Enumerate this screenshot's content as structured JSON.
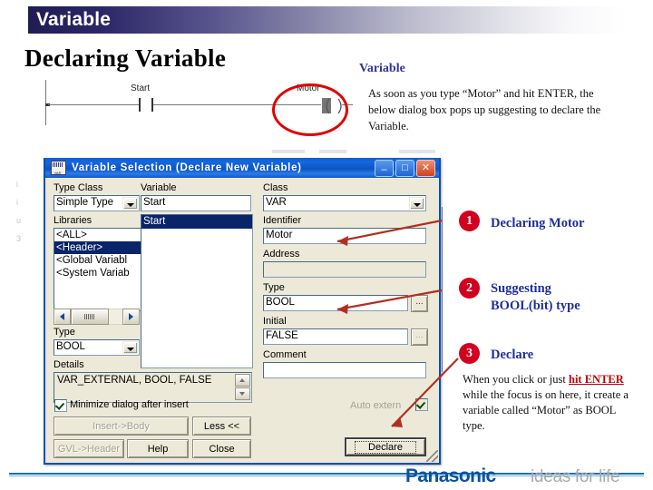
{
  "slide": {
    "header_title": "Variable",
    "page_title": "Declaring Variable"
  },
  "right_panel": {
    "heading": "Variable",
    "paragraph": "As soon as you type “Motor” and hit ENTER, the below dialog box pops up suggesting to declare the Variable."
  },
  "ladder": {
    "contact_label": "Start",
    "coil_label": "Motor"
  },
  "dialog": {
    "title": "Variable Selection (Declare New Variable)",
    "icon": "variable-window-icon",
    "titlebar_buttons": [
      {
        "name": "minimize",
        "glyph": "–"
      },
      {
        "name": "maximize",
        "glyph": "□"
      },
      {
        "name": "close",
        "glyph": "✕"
      }
    ],
    "left_column": {
      "type_class_label": "Type Class",
      "type_class_value": "Simple Type",
      "libraries_label": "Libraries",
      "libraries_items": [
        {
          "label": "<ALL>",
          "selected": false
        },
        {
          "label": "<Header>",
          "selected": true
        },
        {
          "label": "<Global Variabl",
          "selected": false
        },
        {
          "label": "<System Variab",
          "selected": false
        }
      ],
      "type_label": "Type",
      "type_value": "BOOL",
      "details_label": "Details",
      "details_value": "VAR_EXTERNAL, BOOL, FALSE"
    },
    "middle_column": {
      "variable_label": "Variable",
      "variable_value": "Start",
      "variable_list": [
        {
          "label": "Start",
          "selected": true
        }
      ]
    },
    "right_column": {
      "class_label": "Class",
      "class_value": "VAR",
      "identifier_label": "Identifier",
      "identifier_value": "Motor",
      "address_label": "Address",
      "address_value": "",
      "type_label": "Type",
      "type_value": "BOOL",
      "type_browse_label": "...",
      "initial_label": "Initial",
      "initial_value": "FALSE",
      "initial_browse_label": "...",
      "comment_label": "Comment",
      "comment_value": "",
      "auto_extern_label": "Auto extern",
      "auto_extern_checked": true
    },
    "footer": {
      "minimize_checkbox_label": "Minimize dialog after insert",
      "minimize_checkbox_checked": true,
      "insert_body_label": "Insert->Body",
      "less_label": "Less <<",
      "gvl_header_label": "GVL->Header",
      "help_label": "Help",
      "close_label": "Close",
      "declare_label": "Declare"
    }
  },
  "callouts": [
    {
      "number": "1",
      "title": "Declaring Motor"
    },
    {
      "number": "2",
      "title": "Suggesting\nBOOL(bit) type"
    },
    {
      "number": "3",
      "title": "Declare"
    }
  ],
  "callout_2_line1": "Suggesting",
  "callout_2_line2": "BOOL(bit) type",
  "callout_3_body": {
    "part1": "When you click or just ",
    "hl1": "hit ENTER",
    "part2": " while the focus is on here, it create a variable called “Motor” as BOOL type."
  },
  "footer_logo": {
    "brand": "Panasonic",
    "tagline": "ideas for life"
  },
  "colors": {
    "header_gradient_start": "#201c54",
    "annotation_red": "#d2001f",
    "annotation_blue": "#1f2f9e",
    "dialog_title_blue": "#0b5fd0",
    "selection_blue": "#0a246a",
    "brand_blue": "#0a52a0"
  }
}
